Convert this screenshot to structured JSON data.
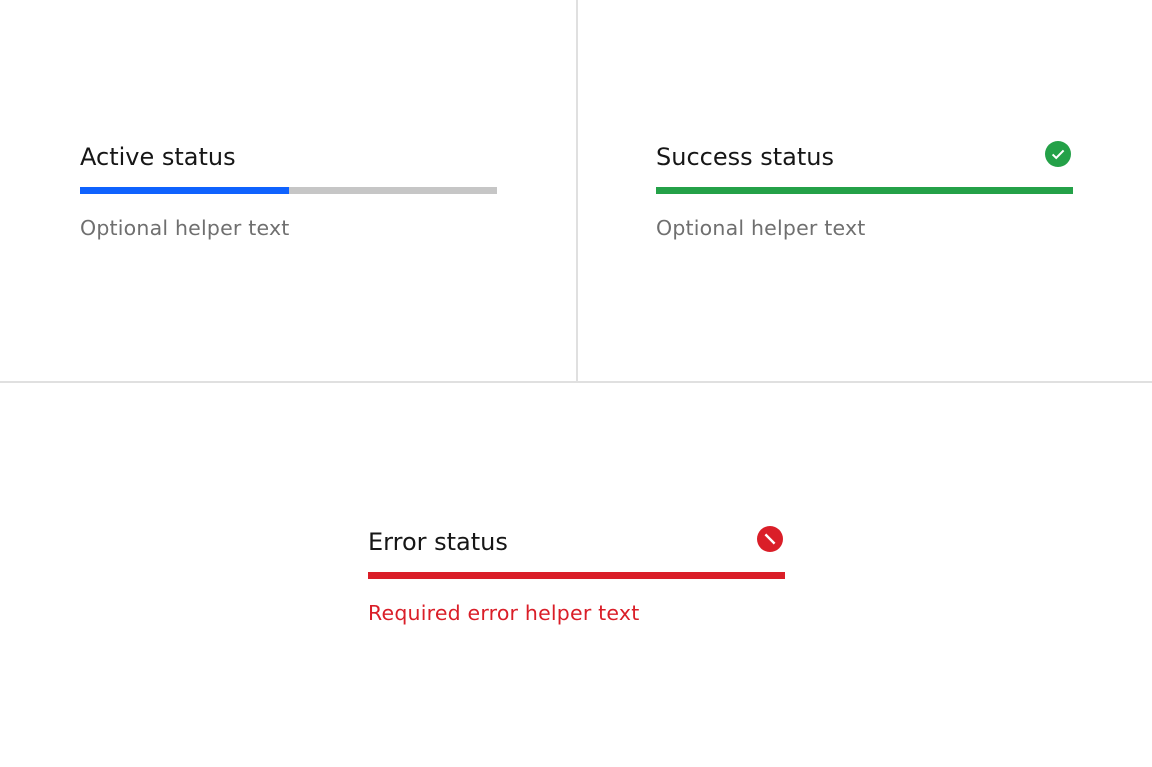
{
  "colors": {
    "active": "#0f62fe",
    "success": "#24a148",
    "error": "#da1e28",
    "track": "#c6c6c6",
    "helper": "#6f6f6f",
    "label": "#161616"
  },
  "indicators": [
    {
      "label": "Active status",
      "helper": "Optional helper text",
      "status": "active",
      "progress": 0.5,
      "icon": null
    },
    {
      "label": "Success status",
      "helper": "Optional helper text",
      "status": "success",
      "progress": 1.0,
      "icon": "checkmark-filled-icon"
    },
    {
      "label": "Error status",
      "helper": "Required error helper text",
      "status": "error",
      "progress": 1.0,
      "icon": "error-filled-icon"
    }
  ]
}
